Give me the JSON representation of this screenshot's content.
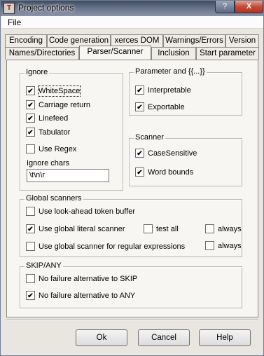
{
  "window": {
    "title": "Project options",
    "help_symbol": "?",
    "close_symbol": "X",
    "icon_text": "T"
  },
  "menu": {
    "file": "File"
  },
  "tabs": {
    "row1": [
      "Encoding",
      "Code generation",
      "xerces DOM",
      "Warnings/Errors",
      "Version"
    ],
    "row2": [
      "Names/Directories",
      "Parser/Scanner",
      "Inclusion",
      "Start parameter"
    ],
    "active": "Parser/Scanner"
  },
  "ignore": {
    "legend": "Ignore",
    "whitespace": {
      "label": "WhiteSpace",
      "checked": true
    },
    "carriage_return": {
      "label": "Carriage return",
      "checked": true
    },
    "linefeed": {
      "label": "Linefeed",
      "checked": true
    },
    "tabulator": {
      "label": "Tabulator",
      "checked": true
    },
    "use_regex": {
      "label": "Use Regex",
      "checked": false
    },
    "chars_label": "Ignore chars",
    "chars_value": "\\t\\n\\r"
  },
  "parameter": {
    "legend": "Parameter and {{...}}",
    "interpretable": {
      "label": "Interpretable",
      "checked": true
    },
    "exportable": {
      "label": "Exportable",
      "checked": true
    }
  },
  "scanner": {
    "legend": "Scanner",
    "case_sensitive": {
      "label": "CaseSensitive",
      "checked": true
    },
    "word_bounds": {
      "label": "Word bounds",
      "checked": true
    }
  },
  "global_scanners": {
    "legend": "Global scanners",
    "look_ahead": {
      "label": "Use look-ahead token buffer",
      "checked": false
    },
    "literal": {
      "label": "Use global literal scanner",
      "checked": true
    },
    "test_all": {
      "label": "test all",
      "checked": false
    },
    "always1": {
      "label": "always",
      "checked": false
    },
    "regex": {
      "label": "Use global scanner for regular expressions",
      "checked": false
    },
    "always2": {
      "label": "always",
      "checked": false
    }
  },
  "skip_any": {
    "legend": "SKIP/ANY",
    "skip": {
      "label": "No failure alternative to SKIP",
      "checked": false
    },
    "any": {
      "label": "No failure alternative to ANY",
      "checked": true
    }
  },
  "buttons": {
    "ok": "Ok",
    "cancel": "Cancel",
    "help": "Help"
  }
}
